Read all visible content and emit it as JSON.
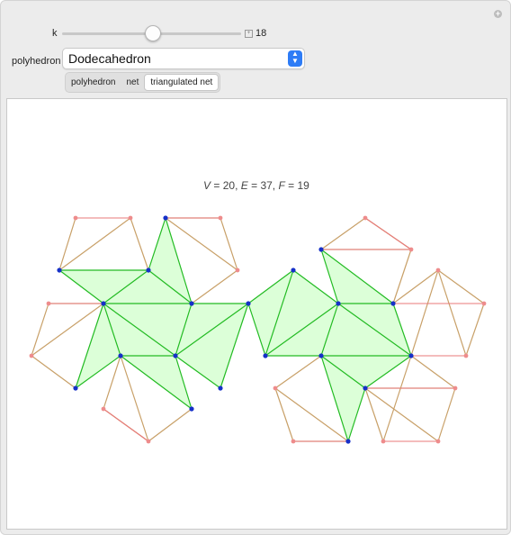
{
  "controls": {
    "k_label": "k",
    "k_value": "18",
    "k_min": 0,
    "k_max": 19,
    "polyhedron_label": "polyhedron",
    "polyhedron_selected": "Dodecahedron"
  },
  "tabs": [
    {
      "label": "polyhedron",
      "active": false
    },
    {
      "label": "net",
      "active": false
    },
    {
      "label": "triangulated net",
      "active": true
    }
  ],
  "stats": {
    "v_label": "V",
    "v_value": "20",
    "e_label": "E",
    "e_value": "37",
    "f_label": "F",
    "f_value": "19"
  },
  "colors": {
    "green_edge": "#22bb22",
    "green_fill": "#dcffd8",
    "tan_edge": "#c8a068",
    "red_edge": "#e87a7a",
    "blue_vertex": "#1630c8",
    "pink_vertex": "#ee8c8c",
    "slider_accent": "#2e7cf6"
  },
  "icons": {
    "corner": "plus-circle-icon",
    "slider_step": "plus-square-icon",
    "select_arrows": "updown-arrows-icon"
  }
}
